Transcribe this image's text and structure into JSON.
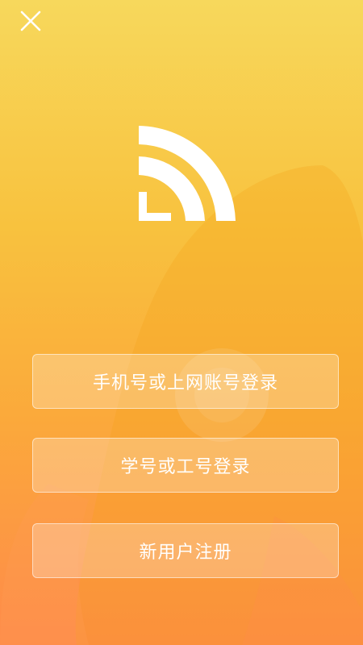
{
  "header": {
    "close_icon": "close-icon"
  },
  "logo": {
    "icon": "wifi-signal-logo-icon"
  },
  "buttons": {
    "phone_login": "手机号或上网账号登录",
    "id_login": "学号或工号登录",
    "register": "新用户注册"
  },
  "colors": {
    "gradient_top": "#f7d85c",
    "gradient_bottom": "#fe8a4a",
    "text": "#ffffff"
  }
}
